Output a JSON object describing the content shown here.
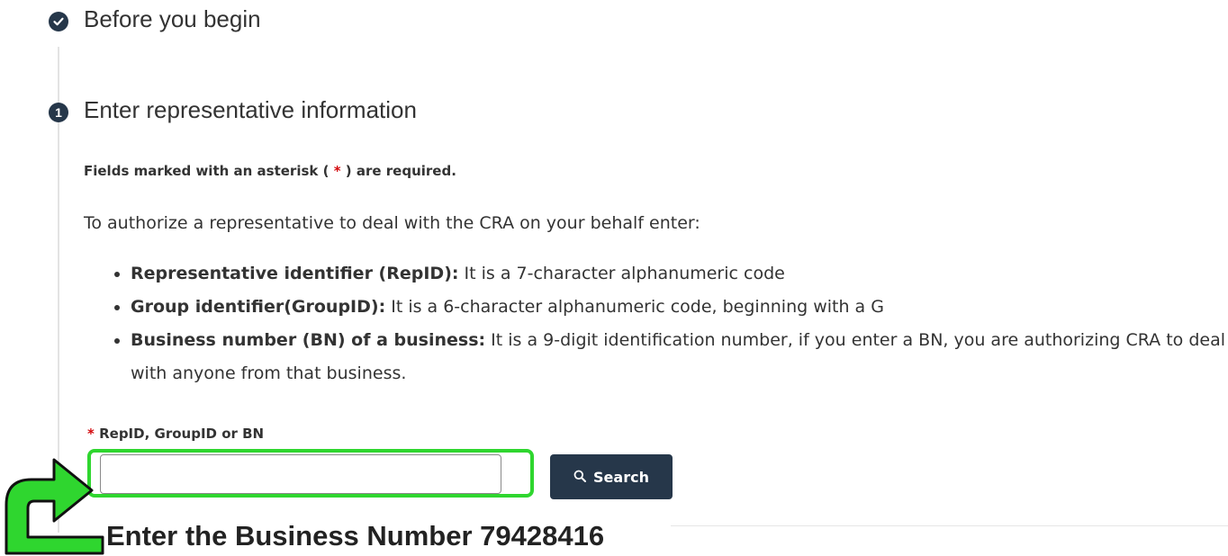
{
  "steps": [
    {
      "status": "complete",
      "title": "Before you begin"
    },
    {
      "number": "1",
      "title": "Enter representative information"
    }
  ],
  "form": {
    "required_note_before": "Fields marked with an asterisk ( ",
    "required_star": "*",
    "required_note_after": " ) are required.",
    "intro": "To authorize a representative to deal with the CRA on your behalf enter:",
    "bullets": [
      {
        "term": "Representative identifier (RepID):",
        "desc": " It is a 7-character alphanumeric code"
      },
      {
        "term": "Group identifier(GroupID):",
        "desc": " It is a 6-character alphanumeric code, beginning with a G"
      },
      {
        "term": "Business number (BN) of a business:",
        "desc": " It is a 9-digit identification number, if you enter a BN, you are authorizing CRA to deal with anyone from that business."
      }
    ],
    "field_label": "RepID, GroupID or BN",
    "field_star": "*",
    "field_value": "",
    "search_label": "Search"
  },
  "annotation": {
    "text": "Enter the Business Number 79428416",
    "highlight_color": "#2fd62f"
  },
  "colors": {
    "primary": "#26374a",
    "required": "#d3080c"
  },
  "icons": [
    "check-circle-icon",
    "step-number-icon",
    "search-icon",
    "curved-arrow-icon"
  ]
}
